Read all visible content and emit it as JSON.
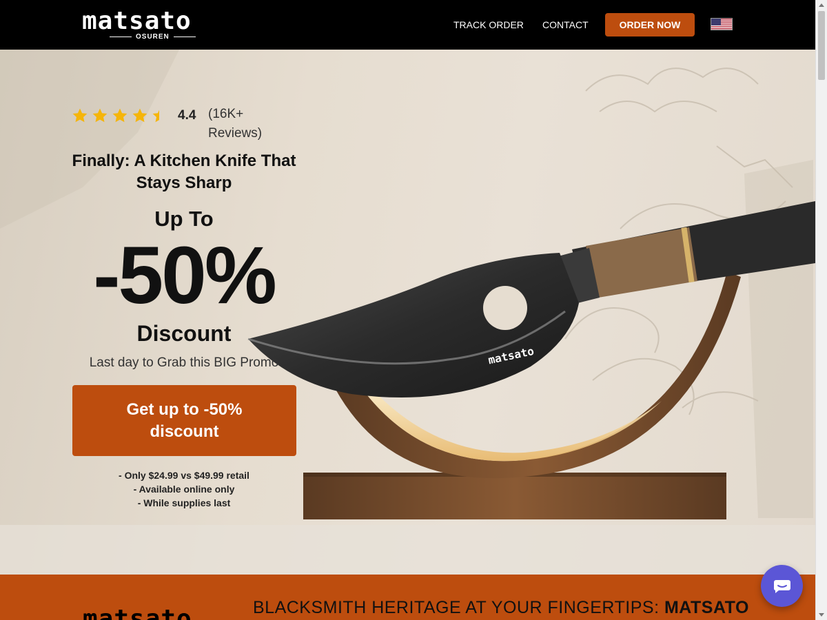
{
  "header": {
    "logo": "matsato",
    "logo_sub": "OSUREN",
    "nav": [
      {
        "label": "TRACK ORDER"
      },
      {
        "label": "CONTACT"
      }
    ],
    "order_button": "ORDER NOW",
    "flag_icon": "us-flag-icon"
  },
  "hero": {
    "rating": {
      "stars": 4.4,
      "value": "4.4",
      "count": "(16K+ Reviews)"
    },
    "headline": "Finally: A Kitchen Knife That Stays Sharp",
    "up_to": "Up To",
    "percent": "-50%",
    "discount": "Discount",
    "promo": "Last day to Grab this BIG Promo",
    "cta": "Get up to -50% discount",
    "bullets": [
      "- Only $24.99 vs $49.99 retail",
      "- Available online only",
      "- While supplies last"
    ],
    "knife_logo": "matsato"
  },
  "band": {
    "logo": "matsato",
    "title_prefix": "BLACKSMITH HERITAGE AT YOUR FINGERTIPS:",
    "title_brand": "MATSATO"
  },
  "colors": {
    "accent": "#bd4d0e",
    "header_bg": "#000000",
    "star": "#f5b50a",
    "chat": "#5b56d6"
  },
  "icons": {
    "chat": "chat-icon",
    "star": "star-icon"
  }
}
